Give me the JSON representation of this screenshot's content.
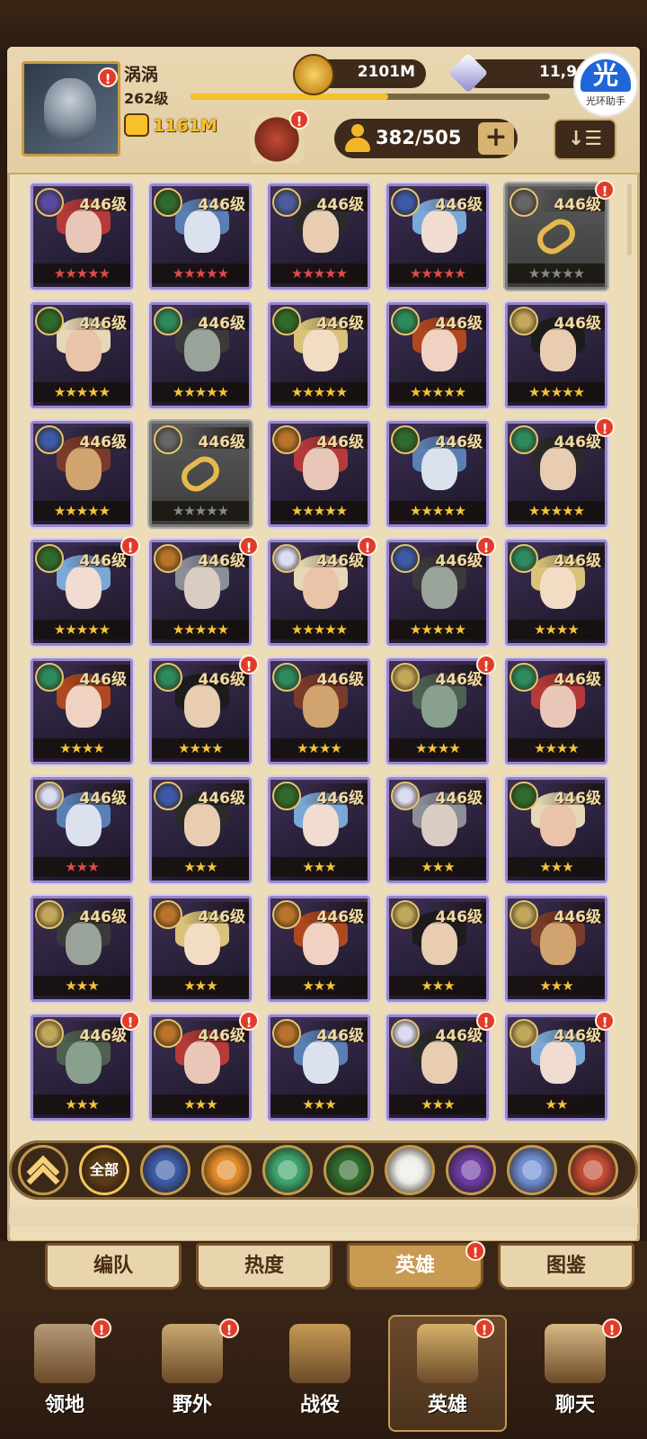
{
  "player": {
    "name": "涡涡",
    "level": "262级",
    "power": "1161M",
    "xp_fraction": 0.55
  },
  "currency": {
    "gold": "2101M",
    "diamonds": "11,9"
  },
  "helper": {
    "logo_text": "光",
    "label": "光环助手"
  },
  "hero_count": "382/505",
  "hero_cards": [
    {
      "level": "446级",
      "stars": 5,
      "star_color": "#e34a4a",
      "locked": false,
      "faction_color": "#5a4aa0",
      "badge": false
    },
    {
      "level": "446级",
      "stars": 5,
      "star_color": "#e34a4a",
      "locked": false,
      "faction_color": "#2f6b2c",
      "badge": false
    },
    {
      "level": "446级",
      "stars": 5,
      "star_color": "#e34a4a",
      "locked": false,
      "faction_color": "#4b5d9b",
      "badge": false
    },
    {
      "level": "446级",
      "stars": 5,
      "star_color": "#e34a4a",
      "locked": false,
      "faction_color": "#3c5aa6",
      "badge": false
    },
    {
      "level": "446级",
      "stars": 5,
      "star_color": "#888888",
      "locked": true,
      "faction_color": "#666666",
      "badge": true
    },
    {
      "level": "446级",
      "stars": 5,
      "star_color": "#f5c43a",
      "locked": false,
      "faction_color": "#2f6b2c",
      "badge": false
    },
    {
      "level": "446级",
      "stars": 5,
      "star_color": "#f5c43a",
      "locked": false,
      "faction_color": "#2d8a5c",
      "badge": false
    },
    {
      "level": "446级",
      "stars": 5,
      "star_color": "#f5c43a",
      "locked": false,
      "faction_color": "#2f6b2c",
      "badge": false
    },
    {
      "level": "446级",
      "stars": 5,
      "star_color": "#f5c43a",
      "locked": false,
      "faction_color": "#2d8a5c",
      "badge": false
    },
    {
      "level": "446级",
      "stars": 5,
      "star_color": "#f5c43a",
      "locked": false,
      "faction_color": "#c2a85a",
      "badge": false
    },
    {
      "level": "446级",
      "stars": 5,
      "star_color": "#f5c43a",
      "locked": false,
      "faction_color": "#3c5aa6",
      "badge": false
    },
    {
      "level": "446级",
      "stars": 5,
      "star_color": "#888888",
      "locked": true,
      "faction_color": "#666666",
      "badge": false
    },
    {
      "level": "446级",
      "stars": 5,
      "star_color": "#f5c43a",
      "locked": false,
      "faction_color": "#b8742a",
      "badge": false
    },
    {
      "level": "446级",
      "stars": 5,
      "star_color": "#f5c43a",
      "locked": false,
      "faction_color": "#2f6b2c",
      "badge": false
    },
    {
      "level": "446级",
      "stars": 5,
      "star_color": "#f5c43a",
      "locked": false,
      "faction_color": "#2d8a5c",
      "badge": true
    },
    {
      "level": "446级",
      "stars": 5,
      "star_color": "#f5c43a",
      "locked": false,
      "faction_color": "#2f6b2c",
      "badge": true
    },
    {
      "level": "446级",
      "stars": 5,
      "star_color": "#f5c43a",
      "locked": false,
      "faction_color": "#b8742a",
      "badge": true
    },
    {
      "level": "446级",
      "stars": 5,
      "star_color": "#f5c43a",
      "locked": false,
      "faction_color": "#dcdcf0",
      "badge": true
    },
    {
      "level": "446级",
      "stars": 5,
      "star_color": "#f5c43a",
      "locked": false,
      "faction_color": "#3c5aa6",
      "badge": true
    },
    {
      "level": "446级",
      "stars": 4,
      "star_color": "#f5c43a",
      "locked": false,
      "faction_color": "#2d8a5c",
      "badge": false
    },
    {
      "level": "446级",
      "stars": 4,
      "star_color": "#f5c43a",
      "locked": false,
      "faction_color": "#2d8a5c",
      "badge": false
    },
    {
      "level": "446级",
      "stars": 4,
      "star_color": "#f5c43a",
      "locked": false,
      "faction_color": "#2d8a5c",
      "badge": true
    },
    {
      "level": "446级",
      "stars": 4,
      "star_color": "#f5c43a",
      "locked": false,
      "faction_color": "#2d8a5c",
      "badge": false
    },
    {
      "level": "446级",
      "stars": 4,
      "star_color": "#f5c43a",
      "locked": false,
      "faction_color": "#c2a85a",
      "badge": true
    },
    {
      "level": "446级",
      "stars": 4,
      "star_color": "#f5c43a",
      "locked": false,
      "faction_color": "#2d8a5c",
      "badge": false
    },
    {
      "level": "446级",
      "stars": 3,
      "star_color": "#e34a4a",
      "locked": false,
      "faction_color": "#dcdcf0",
      "badge": false
    },
    {
      "level": "446级",
      "stars": 3,
      "star_color": "#f5c43a",
      "locked": false,
      "faction_color": "#3c5aa6",
      "badge": false
    },
    {
      "level": "446级",
      "stars": 3,
      "star_color": "#f5c43a",
      "locked": false,
      "faction_color": "#2f6b2c",
      "badge": false
    },
    {
      "level": "446级",
      "stars": 3,
      "star_color": "#f5c43a",
      "locked": false,
      "faction_color": "#dcdcf0",
      "badge": false
    },
    {
      "level": "446级",
      "stars": 3,
      "star_color": "#f5c43a",
      "locked": false,
      "faction_color": "#2f6b2c",
      "badge": false
    },
    {
      "level": "446级",
      "stars": 3,
      "star_color": "#f5c43a",
      "locked": false,
      "faction_color": "#c2a85a",
      "badge": false
    },
    {
      "level": "446级",
      "stars": 3,
      "star_color": "#f5c43a",
      "locked": false,
      "faction_color": "#b8742a",
      "badge": false
    },
    {
      "level": "446级",
      "stars": 3,
      "star_color": "#f5c43a",
      "locked": false,
      "faction_color": "#b8742a",
      "badge": false
    },
    {
      "level": "446级",
      "stars": 3,
      "star_color": "#f5c43a",
      "locked": false,
      "faction_color": "#c2a85a",
      "badge": false
    },
    {
      "level": "446级",
      "stars": 3,
      "star_color": "#f5c43a",
      "locked": false,
      "faction_color": "#c2a85a",
      "badge": false
    },
    {
      "level": "446级",
      "stars": 3,
      "star_color": "#f5c43a",
      "locked": false,
      "faction_color": "#c2a85a",
      "badge": true
    },
    {
      "level": "446级",
      "stars": 3,
      "star_color": "#f5c43a",
      "locked": false,
      "faction_color": "#b8742a",
      "badge": true
    },
    {
      "level": "446级",
      "stars": 3,
      "star_color": "#f5c43a",
      "locked": false,
      "faction_color": "#b8742a",
      "badge": false
    },
    {
      "level": "446级",
      "stars": 3,
      "star_color": "#f5c43a",
      "locked": false,
      "faction_color": "#dcdcf0",
      "badge": true
    },
    {
      "level": "446级",
      "stars": 2,
      "star_color": "#f5c43a",
      "locked": false,
      "faction_color": "#c2a85a",
      "badge": true
    }
  ],
  "filters": [
    {
      "icon": "chevron-up-icon",
      "color": "#3b2818"
    },
    {
      "icon": "all-filter",
      "label": "全部",
      "color": "#5a3a16"
    },
    {
      "icon": "lightbearer-faction-icon",
      "color": "#3c5aa6"
    },
    {
      "icon": "mauler-faction-icon",
      "color": "#e08a2a"
    },
    {
      "icon": "wilder-faction-icon",
      "color": "#3aa46a"
    },
    {
      "icon": "graveborn-faction-icon",
      "color": "#2f6b2c"
    },
    {
      "icon": "celestial-faction-icon",
      "color": "#ecece6"
    },
    {
      "icon": "hypogean-faction-icon",
      "color": "#6a3aa0"
    },
    {
      "icon": "dimensional-faction-icon",
      "color": "#6f8bd0"
    },
    {
      "icon": "draconis-faction-icon",
      "color": "#c14a34"
    }
  ],
  "tabs": [
    {
      "label": "编队",
      "active": false,
      "badge": false
    },
    {
      "label": "热度",
      "active": false,
      "badge": false
    },
    {
      "label": "英雄",
      "active": true,
      "badge": true
    },
    {
      "label": "图鉴",
      "active": false,
      "badge": false
    }
  ],
  "nav": [
    {
      "label": "领地",
      "icon": "castle-icon",
      "active": false,
      "badge": true,
      "color": "#b59a78"
    },
    {
      "label": "野外",
      "icon": "map-scroll-icon",
      "active": false,
      "badge": true,
      "color": "#c9a873"
    },
    {
      "label": "战役",
      "icon": "sword-icon",
      "active": false,
      "badge": false,
      "color": "#c79a54"
    },
    {
      "label": "英雄",
      "icon": "helmet-icon",
      "active": true,
      "badge": true,
      "color": "#d6b16c"
    },
    {
      "label": "聊天",
      "icon": "chat-bubble-icon",
      "active": false,
      "badge": true,
      "color": "#d9b985"
    }
  ],
  "badge_text": "!",
  "sort_label": "↓☰",
  "plus_label": "+"
}
